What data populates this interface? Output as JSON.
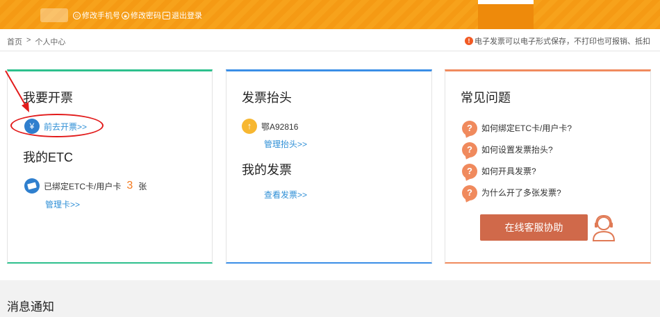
{
  "topbar": {
    "links": [
      {
        "icon": "smile-icon",
        "label": "修改手机号"
      },
      {
        "icon": "lock-icon",
        "label": "修改密码"
      },
      {
        "icon": "exit-icon",
        "label": "退出登录"
      }
    ]
  },
  "breadcrumb": {
    "home": "首页",
    "separator": ">",
    "current": "个人中心"
  },
  "notice": {
    "icon": "warning-icon",
    "text": "电子发票可以电子形式保存，不打印也可报销、抵扣"
  },
  "card_invoice": {
    "title": "我要开票",
    "action_link": "前去开票>>",
    "etc_title": "我的ETC",
    "bound_prefix": "已绑定ETC卡/用户卡",
    "bound_count": "3",
    "bound_suffix": "张",
    "manage_link": "管理卡>>"
  },
  "card_header": {
    "title": "发票抬头",
    "plate": "鄂A92816",
    "manage_link": "管理抬头>>",
    "invoice_title": "我的发票",
    "view_link": "查看发票>>"
  },
  "card_faq": {
    "title": "常见问题",
    "items": [
      "如何绑定ETC卡/用户卡?",
      "如何设置发票抬头?",
      "如何开具发票?",
      "为什么开了多张发票?"
    ],
    "service_button": "在线客服协助"
  },
  "messages": {
    "title": "消息通知"
  },
  "colors": {
    "topbar": "#f7a21b",
    "green": "#2dc08d",
    "blue": "#3a8ee6",
    "orange": "#f08a5d",
    "link": "#2f8fd6",
    "annotation": "#e21b1b"
  }
}
